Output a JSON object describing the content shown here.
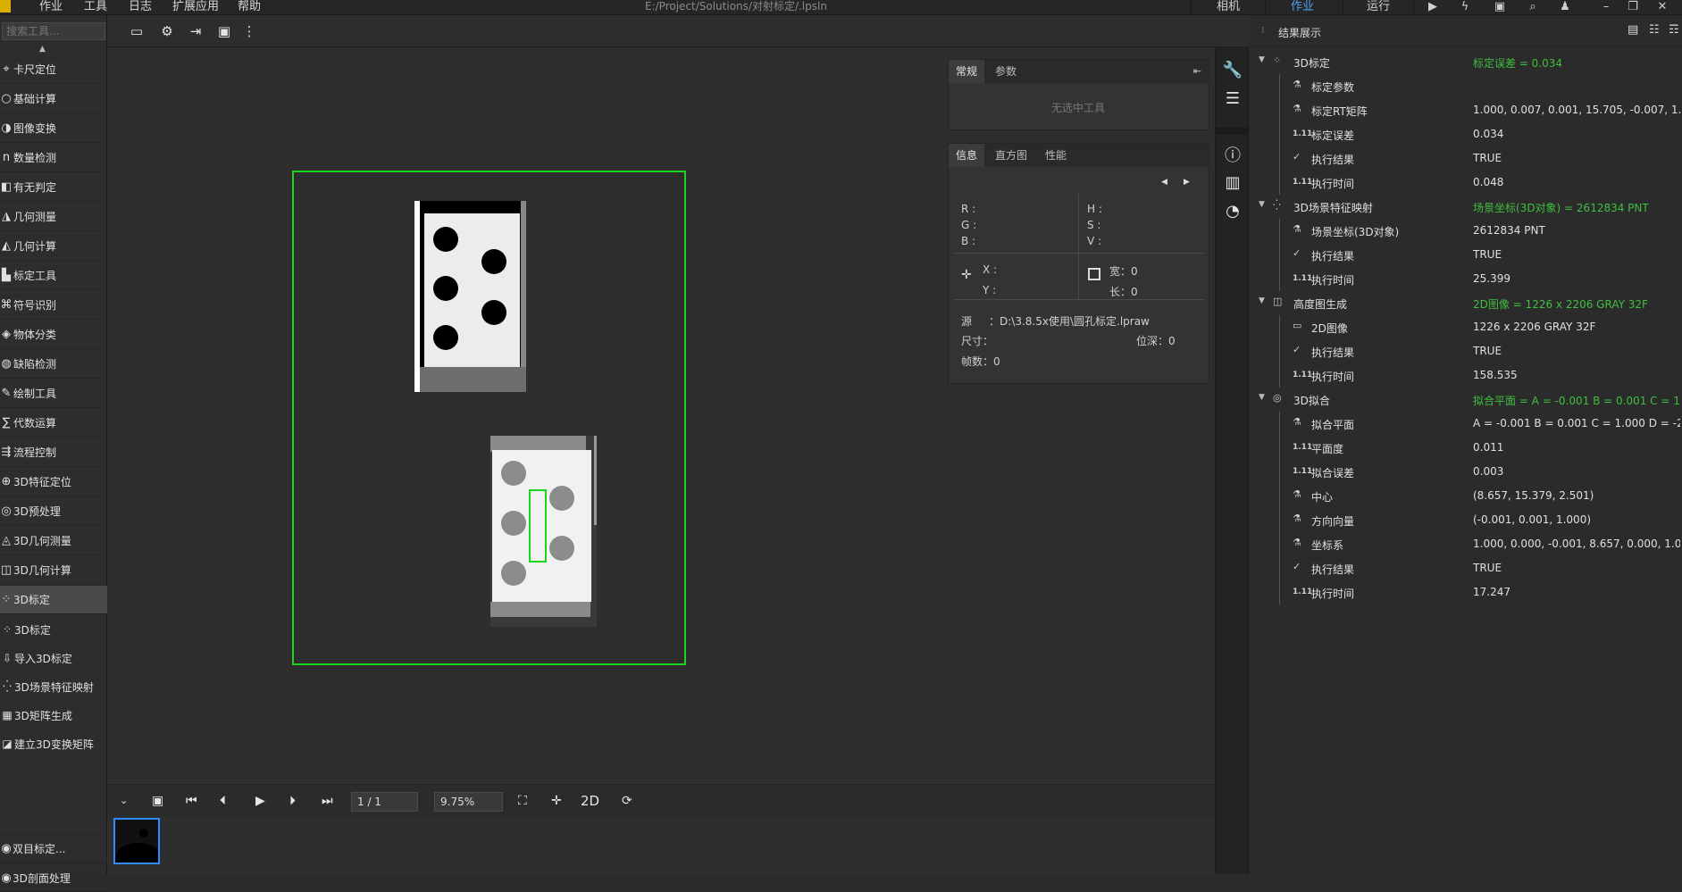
{
  "menubar": {
    "items": [
      "作业",
      "工具",
      "日志",
      "扩展应用",
      "帮助"
    ],
    "title": "E:/Project/Solutions/对射标定/.lpsln",
    "right_tabs": [
      "相机",
      "作业",
      "运行"
    ]
  },
  "left": {
    "search_placeholder": "搜索工具...",
    "categories": [
      {
        "label": "卡尺定位",
        "icon": "caliper-icon"
      },
      {
        "label": "基础计算",
        "icon": "circle-icon"
      },
      {
        "label": "图像变换",
        "icon": "transform-icon"
      },
      {
        "label": "数量检测",
        "icon": "count-icon"
      },
      {
        "label": "有无判定",
        "icon": "presence-icon"
      },
      {
        "label": "几何测量",
        "icon": "geometry-measure-icon"
      },
      {
        "label": "几何计算",
        "icon": "geometry-calc-icon"
      },
      {
        "label": "标定工具",
        "icon": "calibration-icon"
      },
      {
        "label": "符号识别",
        "icon": "symbol-icon"
      },
      {
        "label": "物体分类",
        "icon": "classify-icon"
      },
      {
        "label": "缺陷检测",
        "icon": "defect-icon"
      },
      {
        "label": "绘制工具",
        "icon": "draw-icon"
      },
      {
        "label": "代数运算",
        "icon": "algebra-icon"
      },
      {
        "label": "流程控制",
        "icon": "flow-icon"
      },
      {
        "label": "3D特征定位",
        "icon": "3d-feature-icon"
      },
      {
        "label": "3D预处理",
        "icon": "3d-preprocess-icon"
      },
      {
        "label": "3D几何测量",
        "icon": "3d-measure-icon"
      },
      {
        "label": "3D几何计算",
        "icon": "3d-calc-icon"
      },
      {
        "label": "3D标定",
        "icon": "3d-calib-icon"
      }
    ],
    "sub_items": [
      {
        "label": "3D标定",
        "icon": "3d-calib-icon"
      },
      {
        "label": "导入3D标定",
        "icon": "import-icon"
      },
      {
        "label": "3D场景特征映射",
        "icon": "scene-map-icon"
      },
      {
        "label": "3D矩阵生成",
        "icon": "matrix-icon"
      },
      {
        "label": "建立3D变换矩阵",
        "icon": "transform-matrix-icon"
      }
    ],
    "bottom_items": [
      "双目标定...",
      "3D剖面处理"
    ]
  },
  "inspector": {
    "tabs1": [
      "常规",
      "参数"
    ],
    "no_tool": "无选中工具",
    "tabs2": [
      "信息",
      "直方图",
      "性能"
    ],
    "rgb": {
      "r": "R :",
      "g": "G :",
      "b": "B :"
    },
    "hsv": {
      "h": "H :",
      "s": "S :",
      "v": "V :"
    },
    "x": "X :",
    "y": "Y :",
    "width": "宽：0",
    "length": "长：0",
    "source_label": "源",
    "source_value": "：D:\\3.8.5x使用\\圆孔标定.lpraw",
    "size_label": "尺寸：",
    "depth_label": "位深：0",
    "frames_label": "帧数：0"
  },
  "results": {
    "header": "结果展示",
    "rows": [
      {
        "level": 0,
        "name": "3D标定",
        "value": "标定误差 = 0.034",
        "green": true,
        "icon": "3d-calib-icon"
      },
      {
        "level": 1,
        "name": "标定参数",
        "value": "",
        "green": false,
        "icon": "flask-icon"
      },
      {
        "level": 1,
        "name": "标定RT矩阵",
        "value": "1.000, 0.007, 0.001, 15.705, -0.007, 1.00...",
        "green": false,
        "icon": "flask-icon"
      },
      {
        "level": 1,
        "name": "标定误差",
        "value": "0.034",
        "green": false,
        "icon": "number-icon"
      },
      {
        "level": 1,
        "name": "执行结果",
        "value": "TRUE",
        "green": false,
        "icon": "check-icon"
      },
      {
        "level": 1,
        "name": "执行时间",
        "value": "0.048",
        "green": false,
        "icon": "number-icon"
      },
      {
        "level": 0,
        "name": "3D场景特征映射",
        "value": "场景坐标(3D对象) = 2612834 PNT",
        "green": true,
        "icon": "scene-map-icon"
      },
      {
        "level": 1,
        "name": "场景坐标(3D对象)",
        "value": "2612834 PNT",
        "green": false,
        "icon": "flask-icon"
      },
      {
        "level": 1,
        "name": "执行结果",
        "value": "TRUE",
        "green": false,
        "icon": "check-icon"
      },
      {
        "level": 1,
        "name": "执行时间",
        "value": "25.399",
        "green": false,
        "icon": "number-icon"
      },
      {
        "level": 0,
        "name": "高度图生成",
        "value": "2D图像 = 1226 x 2206 GRAY 32F",
        "green": true,
        "icon": "heightmap-icon"
      },
      {
        "level": 1,
        "name": "2D图像",
        "value": "1226 x 2206 GRAY 32F",
        "green": false,
        "icon": "image-icon"
      },
      {
        "level": 1,
        "name": "执行结果",
        "value": "TRUE",
        "green": false,
        "icon": "check-icon"
      },
      {
        "level": 1,
        "name": "执行时间",
        "value": "158.535",
        "green": false,
        "icon": "number-icon"
      },
      {
        "level": 0,
        "name": "3D拟合",
        "value": "拟合平面 = A = -0.001 B = 0.001 C = 1...",
        "green": true,
        "icon": "fit-icon"
      },
      {
        "level": 1,
        "name": "拟合平面",
        "value": "A = -0.001 B = 0.001 C = 1.000 D = -2...",
        "green": false,
        "icon": "flask-icon"
      },
      {
        "level": 1,
        "name": "平面度",
        "value": "0.011",
        "green": false,
        "icon": "number-icon"
      },
      {
        "level": 1,
        "name": "拟合误差",
        "value": "0.003",
        "green": false,
        "icon": "number-icon"
      },
      {
        "level": 1,
        "name": "中心",
        "value": "(8.657, 15.379, 2.501)",
        "green": false,
        "icon": "flask-icon"
      },
      {
        "level": 1,
        "name": "方向向量",
        "value": "(-0.001, 0.001, 1.000)",
        "green": false,
        "icon": "flask-icon"
      },
      {
        "level": 1,
        "name": "坐标系",
        "value": "1.000, 0.000, -0.001, 8.657, 0.000, 1.000,...",
        "green": false,
        "icon": "flask-icon"
      },
      {
        "level": 1,
        "name": "执行结果",
        "value": "TRUE",
        "green": false,
        "icon": "check-icon"
      },
      {
        "level": 1,
        "name": "执行时间",
        "value": "17.247",
        "green": false,
        "icon": "number-icon"
      }
    ]
  },
  "bottom": {
    "frame": "1 / 1",
    "zoom": "9.75%",
    "mode": "2D"
  }
}
